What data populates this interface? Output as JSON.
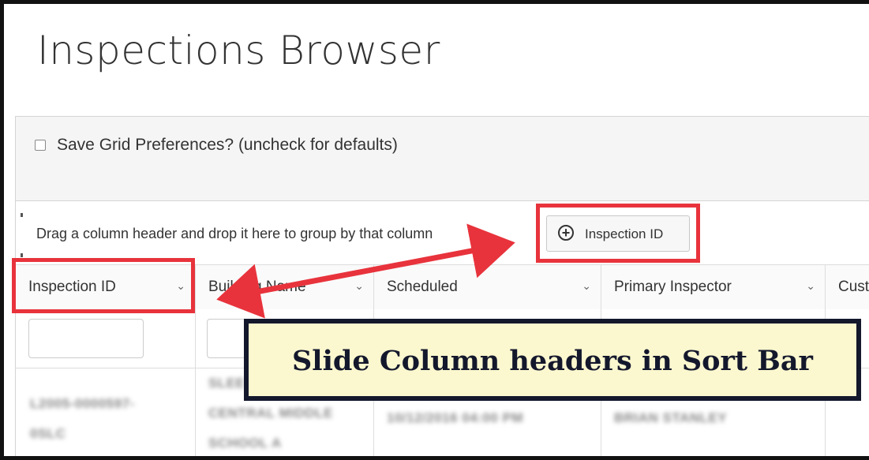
{
  "page": {
    "title": "Inspections Browser"
  },
  "prefs": {
    "checkbox_label": "Save Grid Preferences? (uncheck for defaults)",
    "checked": false
  },
  "group_bar": {
    "hint": "Drag a column header and drop it here to group by that column",
    "chip_label": "Inspection ID",
    "chip_icon": "plus-circle-icon"
  },
  "columns": [
    {
      "label": "Inspection ID",
      "icon": "chevron-down-icon"
    },
    {
      "label": "Building Name",
      "icon": "chevron-down-icon"
    },
    {
      "label": "Scheduled",
      "icon": "chevron-down-icon"
    },
    {
      "label": "Primary Inspector",
      "icon": "chevron-down-icon"
    },
    {
      "label": "Custo",
      "icon": "chevron-down-icon"
    }
  ],
  "row": {
    "inspection_id": "L2005-0000597-\n0SLC",
    "building_name": "SLEE\nCENTRAL MIDDLE\nSCHOOL A",
    "scheduled": "10/12/2016 04:00 PM",
    "primary_inspector": "BRIAN STANLEY"
  },
  "callout": {
    "text": "Slide Column headers in Sort Bar"
  },
  "colors": {
    "highlight": "#e8333c",
    "callout_bg": "#fbf7cf",
    "callout_border": "#14182c"
  }
}
